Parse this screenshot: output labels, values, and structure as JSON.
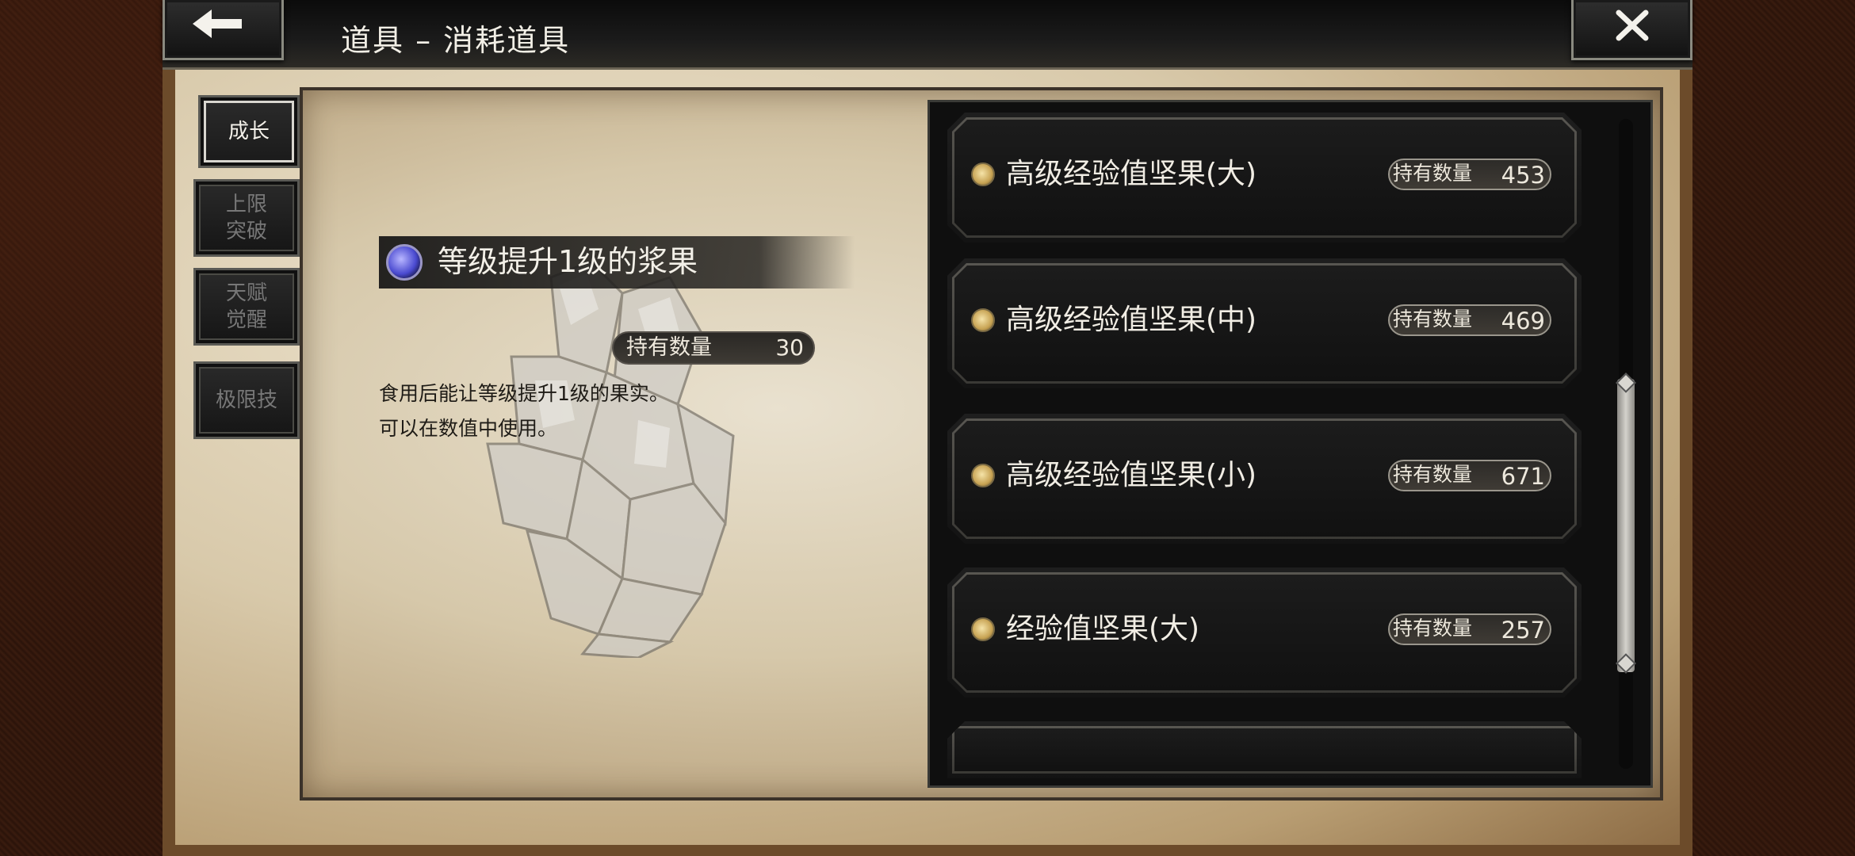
{
  "header": {
    "title": "道具 – 消耗道具",
    "back_icon": "arrow-left-icon",
    "close_icon": "close-icon"
  },
  "sidebar": {
    "tabs": [
      {
        "label": "成长",
        "active": true
      },
      {
        "label": "上限\n突破",
        "active": false
      },
      {
        "label": "天赋\n觉醒",
        "active": false
      },
      {
        "label": "极限技",
        "active": false
      }
    ]
  },
  "detail": {
    "name": "等级提升1级的浆果",
    "qty_label": "持有数量",
    "qty_value": "30",
    "desc_line1": "食用后能让等级提升1级的果实。",
    "desc_line2": "可以在数值中使用。",
    "icon": "berry-icon"
  },
  "items": [
    {
      "name": "高级经验值坚果(大)",
      "qty_label": "持有数量",
      "qty": "453"
    },
    {
      "name": "高级经验值坚果(中)",
      "qty_label": "持有数量",
      "qty": "469"
    },
    {
      "name": "高级经验值坚果(小)",
      "qty_label": "持有数量",
      "qty": "671"
    },
    {
      "name": "经验值坚果(大)",
      "qty_label": "持有数量",
      "qty": "257"
    }
  ],
  "colors": {
    "accent_text": "#f1ede4",
    "parchment": "#d8c9aa",
    "dark_panel": "#111111"
  }
}
